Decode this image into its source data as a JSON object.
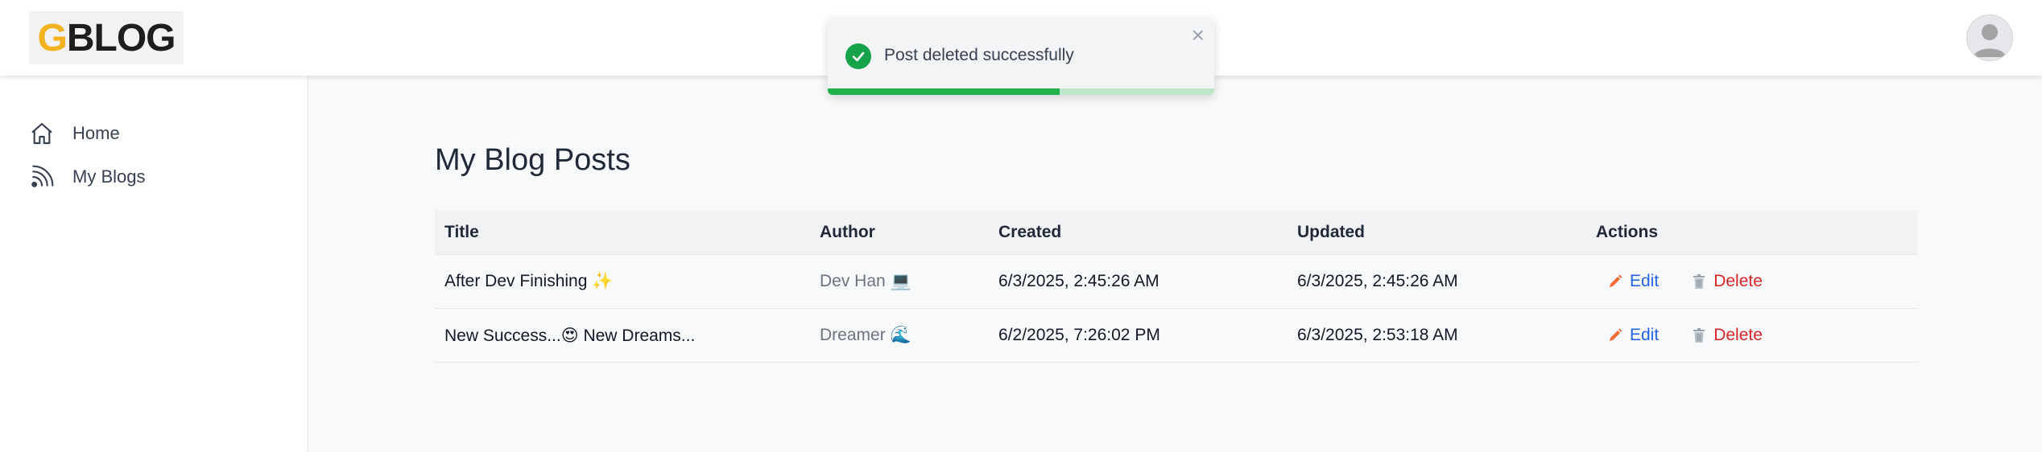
{
  "header": {
    "logo_text": "GBLOG",
    "logo_first_letter": "G",
    "logo_rest": "BLOG",
    "brand_color": "#f3b321"
  },
  "sidebar": {
    "items": [
      {
        "label": "Home",
        "icon": "home-icon"
      },
      {
        "label": "My Blogs",
        "icon": "rss-icon"
      }
    ]
  },
  "toast": {
    "message": "Post deleted successfully",
    "close": "×",
    "progress": 0.6,
    "color": "#22b24c"
  },
  "main": {
    "title": "My Blog Posts",
    "columns": [
      "Title",
      "Author",
      "Created",
      "Updated",
      "Actions"
    ],
    "rows": [
      {
        "title": "After Dev Finishing ✨",
        "author": "Dev Han 💻",
        "created": "6/3/2025, 2:45:26 AM",
        "updated": "6/3/2025, 2:45:26 AM",
        "edit": "Edit",
        "delete": "Delete"
      },
      {
        "title": "New Success...😍 New Dreams...",
        "author": "Dreamer 🌊",
        "created": "6/2/2025, 7:26:02 PM",
        "updated": "6/3/2025, 2:53:18 AM",
        "edit": "Edit",
        "delete": "Delete"
      }
    ]
  }
}
